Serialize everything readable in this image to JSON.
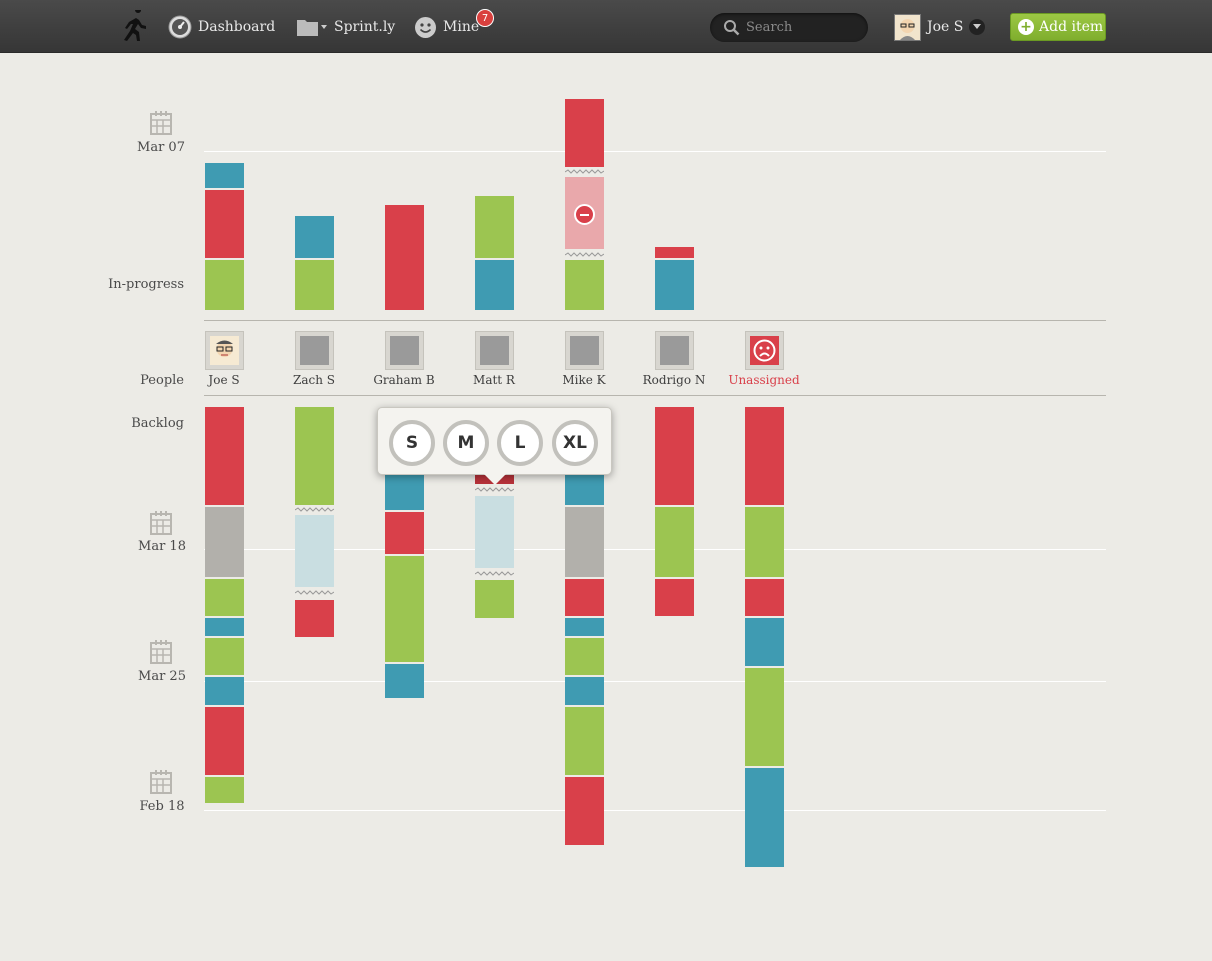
{
  "nav": {
    "dashboard": "Dashboard",
    "project": "Sprint.ly",
    "mine": "Mine",
    "mine_count": "7"
  },
  "search": {
    "placeholder": "Search"
  },
  "user": {
    "name": "Joe S"
  },
  "actions": {
    "add_item": "Add item"
  },
  "rows": {
    "in_progress": "In-progress",
    "people": "People",
    "backlog": "Backlog"
  },
  "dates": {
    "d1": "Mar 07",
    "d2": "Mar 18",
    "d3": "Mar 25",
    "d4": "Feb 18"
  },
  "people": [
    "Joe S",
    "Zach S",
    "Graham B",
    "Matt R",
    "Mike K",
    "Rodrigo N",
    "Unassigned"
  ],
  "size_picker": [
    "S",
    "M",
    "L",
    "XL"
  ],
  "colors": {
    "red": "#d9404a",
    "green": "#9cc551",
    "teal": "#3f9bb2",
    "grey": "#b2b0ab",
    "accent_green": "#8bbb37"
  },
  "icons": [
    "runner-logo-icon",
    "dashboard-gauge-icon",
    "folder-icon",
    "smiley-icon",
    "search-icon",
    "chevron-down-icon",
    "plus-icon",
    "calendar-icon",
    "remove-icon",
    "sad-face-icon"
  ]
}
